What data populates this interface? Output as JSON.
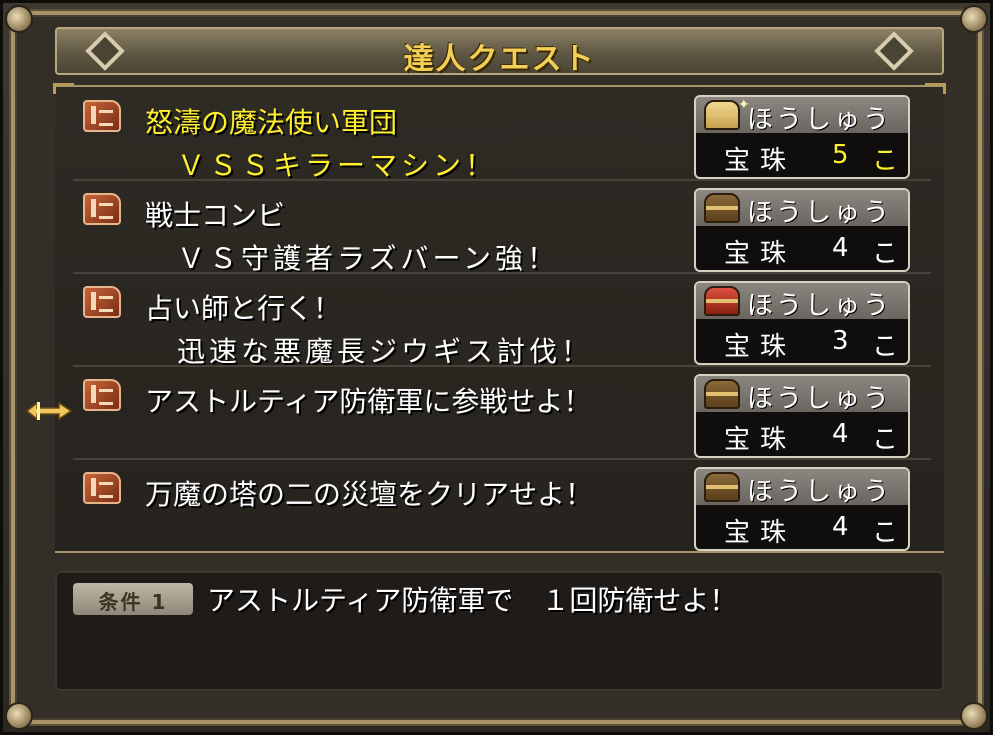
{
  "window": {
    "title": "達人クエスト"
  },
  "quests": [
    {
      "line1": "怒濤の魔法使い軍団",
      "line2": "ＶＳＳキラーマシン！",
      "reward_label": "ほうしゅう",
      "reward_item": "宝珠",
      "reward_count": "5",
      "reward_unit": "こ",
      "chest_icon": "gold-chest-icon",
      "highlighted": true
    },
    {
      "line1": "戦士コンビ",
      "line2": "ＶＳ守護者ラズバーン強！",
      "reward_label": "ほうしゅう",
      "reward_item": "宝珠",
      "reward_count": "4",
      "reward_unit": "こ",
      "chest_icon": "brown-chest-icon",
      "highlighted": false
    },
    {
      "line1": "占い師と行く！",
      "line2": "迅速な悪魔長ジウギス討伐！",
      "reward_label": "ほうしゅう",
      "reward_item": "宝珠",
      "reward_count": "3",
      "reward_unit": "こ",
      "chest_icon": "red-chest-icon",
      "highlighted": false
    },
    {
      "line1": "アストルティア防衛軍に参戦せよ！",
      "line2": "",
      "reward_label": "ほうしゅう",
      "reward_item": "宝珠",
      "reward_count": "4",
      "reward_unit": "こ",
      "chest_icon": "brown-chest-icon",
      "highlighted": false,
      "cursor": true
    },
    {
      "line1": "万魔の塔の二の災壇をクリアせよ！",
      "line2": "",
      "reward_label": "ほうしゅう",
      "reward_item": "宝珠",
      "reward_count": "4",
      "reward_unit": "こ",
      "chest_icon": "brown-chest-icon",
      "highlighted": false
    }
  ],
  "condition": {
    "badge": "条件 1",
    "text": "アストルティア防衛軍で　１回防衛せよ！"
  },
  "colors": {
    "highlight_text": "#ffef2c",
    "title_text": "#f3cf55",
    "frame_gold": "#a89468"
  }
}
